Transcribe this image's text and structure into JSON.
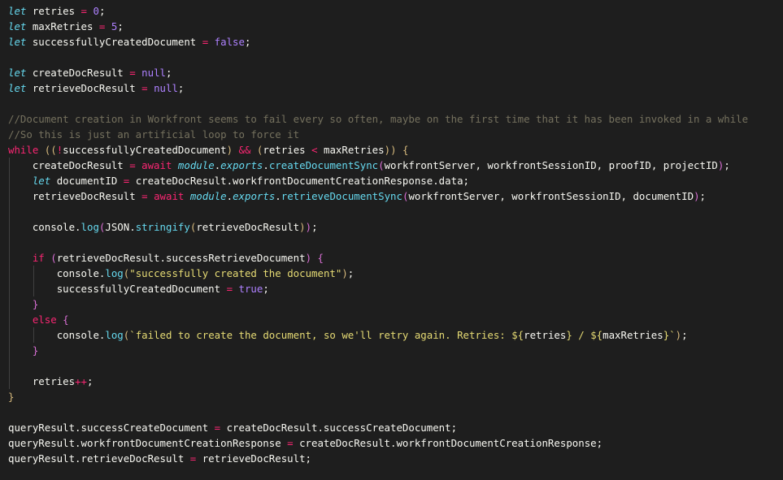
{
  "editor": {
    "background": "#1e1e1e",
    "colors": {
      "keyword": "#66d9ef",
      "control": "#f92672",
      "number": "#ae81ff",
      "comment": "#75715e",
      "string": "#e6db74",
      "function": "#66d9ef",
      "text": "#f8f8f2",
      "brace": "#d7ba7d"
    },
    "lines": [
      [
        {
          "t": "let",
          "c": "keyword-italic"
        },
        {
          "t": " retries ",
          "c": "ident"
        },
        {
          "t": "=",
          "c": "operator"
        },
        {
          "t": " ",
          "c": "plain"
        },
        {
          "t": "0",
          "c": "number"
        },
        {
          "t": ";",
          "c": "plain"
        }
      ],
      [
        {
          "t": "let",
          "c": "keyword-italic"
        },
        {
          "t": " maxRetries ",
          "c": "ident"
        },
        {
          "t": "=",
          "c": "operator"
        },
        {
          "t": " ",
          "c": "plain"
        },
        {
          "t": "5",
          "c": "number"
        },
        {
          "t": ";",
          "c": "plain"
        }
      ],
      [
        {
          "t": "let",
          "c": "keyword-italic"
        },
        {
          "t": " successfullyCreatedDocument ",
          "c": "ident"
        },
        {
          "t": "=",
          "c": "operator"
        },
        {
          "t": " ",
          "c": "plain"
        },
        {
          "t": "false",
          "c": "constant"
        },
        {
          "t": ";",
          "c": "plain"
        }
      ],
      [],
      [
        {
          "t": "let",
          "c": "keyword-italic"
        },
        {
          "t": " createDocResult ",
          "c": "ident"
        },
        {
          "t": "=",
          "c": "operator"
        },
        {
          "t": " ",
          "c": "plain"
        },
        {
          "t": "null",
          "c": "constant"
        },
        {
          "t": ";",
          "c": "plain"
        }
      ],
      [
        {
          "t": "let",
          "c": "keyword-italic"
        },
        {
          "t": " retrieveDocResult ",
          "c": "ident"
        },
        {
          "t": "=",
          "c": "operator"
        },
        {
          "t": " ",
          "c": "plain"
        },
        {
          "t": "null",
          "c": "constant"
        },
        {
          "t": ";",
          "c": "plain"
        }
      ],
      [],
      [
        {
          "t": "//Document creation in Workfront seems to fail every so often, maybe on the first time that it has been invoked in a while",
          "c": "comment"
        }
      ],
      [
        {
          "t": "//So this is just an artificial loop to force it",
          "c": "comment"
        }
      ],
      [
        {
          "t": "while",
          "c": "control"
        },
        {
          "t": " ",
          "c": "plain"
        },
        {
          "t": "((",
          "c": "bracket"
        },
        {
          "t": "!",
          "c": "operator"
        },
        {
          "t": "successfullyCreatedDocument",
          "c": "ident"
        },
        {
          "t": ")",
          "c": "bracket"
        },
        {
          "t": " ",
          "c": "plain"
        },
        {
          "t": "&&",
          "c": "operator"
        },
        {
          "t": " ",
          "c": "plain"
        },
        {
          "t": "(",
          "c": "bracket"
        },
        {
          "t": "retries ",
          "c": "ident"
        },
        {
          "t": "<",
          "c": "operator"
        },
        {
          "t": " maxRetries",
          "c": "ident"
        },
        {
          "t": "))",
          "c": "bracket"
        },
        {
          "t": " ",
          "c": "plain"
        },
        {
          "t": "{",
          "c": "bracket"
        }
      ],
      [
        {
          "t": "    ",
          "c": "plain"
        },
        {
          "t": "createDocResult ",
          "c": "ident"
        },
        {
          "t": "=",
          "c": "operator"
        },
        {
          "t": " ",
          "c": "plain"
        },
        {
          "t": "await",
          "c": "await"
        },
        {
          "t": " ",
          "c": "plain"
        },
        {
          "t": "module",
          "c": "module"
        },
        {
          "t": ".",
          "c": "plain"
        },
        {
          "t": "exports",
          "c": "module"
        },
        {
          "t": ".",
          "c": "plain"
        },
        {
          "t": "createDocumentSync",
          "c": "function"
        },
        {
          "t": "(",
          "c": "paren-alt"
        },
        {
          "t": "workfrontServer, workfrontSessionID, proofID, projectID",
          "c": "ident"
        },
        {
          "t": ")",
          "c": "paren-alt"
        },
        {
          "t": ";",
          "c": "plain"
        }
      ],
      [
        {
          "t": "    ",
          "c": "plain"
        },
        {
          "t": "let",
          "c": "keyword-italic"
        },
        {
          "t": " documentID ",
          "c": "ident"
        },
        {
          "t": "=",
          "c": "operator"
        },
        {
          "t": " createDocResult.workfrontDocumentCreationResponse.data;",
          "c": "ident"
        }
      ],
      [
        {
          "t": "    ",
          "c": "plain"
        },
        {
          "t": "retrieveDocResult ",
          "c": "ident"
        },
        {
          "t": "=",
          "c": "operator"
        },
        {
          "t": " ",
          "c": "plain"
        },
        {
          "t": "await",
          "c": "await"
        },
        {
          "t": " ",
          "c": "plain"
        },
        {
          "t": "module",
          "c": "module"
        },
        {
          "t": ".",
          "c": "plain"
        },
        {
          "t": "exports",
          "c": "module"
        },
        {
          "t": ".",
          "c": "plain"
        },
        {
          "t": "retrieveDocumentSync",
          "c": "function"
        },
        {
          "t": "(",
          "c": "paren-alt"
        },
        {
          "t": "workfrontServer, workfrontSessionID, documentID",
          "c": "ident"
        },
        {
          "t": ")",
          "c": "paren-alt"
        },
        {
          "t": ";",
          "c": "plain"
        }
      ],
      [],
      [
        {
          "t": "    ",
          "c": "plain"
        },
        {
          "t": "console.",
          "c": "ident"
        },
        {
          "t": "log",
          "c": "function"
        },
        {
          "t": "(",
          "c": "paren-alt"
        },
        {
          "t": "JSON.",
          "c": "ident"
        },
        {
          "t": "stringify",
          "c": "function"
        },
        {
          "t": "(",
          "c": "bracket"
        },
        {
          "t": "retrieveDocResult",
          "c": "ident"
        },
        {
          "t": ")",
          "c": "bracket"
        },
        {
          "t": ")",
          "c": "paren-alt"
        },
        {
          "t": ";",
          "c": "plain"
        }
      ],
      [],
      [
        {
          "t": "    ",
          "c": "plain"
        },
        {
          "t": "if",
          "c": "control"
        },
        {
          "t": " ",
          "c": "plain"
        },
        {
          "t": "(",
          "c": "paren-alt"
        },
        {
          "t": "retrieveDocResult.successRetrieveDocument",
          "c": "ident"
        },
        {
          "t": ")",
          "c": "paren-alt"
        },
        {
          "t": " ",
          "c": "plain"
        },
        {
          "t": "{",
          "c": "paren-alt"
        }
      ],
      [
        {
          "t": "        ",
          "c": "plain"
        },
        {
          "t": "console.",
          "c": "ident"
        },
        {
          "t": "log",
          "c": "function"
        },
        {
          "t": "(",
          "c": "bracket"
        },
        {
          "t": "\"successfully created the document\"",
          "c": "string"
        },
        {
          "t": ")",
          "c": "bracket"
        },
        {
          "t": ";",
          "c": "plain"
        }
      ],
      [
        {
          "t": "        ",
          "c": "plain"
        },
        {
          "t": "successfullyCreatedDocument ",
          "c": "ident"
        },
        {
          "t": "=",
          "c": "operator"
        },
        {
          "t": " ",
          "c": "plain"
        },
        {
          "t": "true",
          "c": "constant"
        },
        {
          "t": ";",
          "c": "plain"
        }
      ],
      [
        {
          "t": "    ",
          "c": "plain"
        },
        {
          "t": "}",
          "c": "paren-alt"
        }
      ],
      [
        {
          "t": "    ",
          "c": "plain"
        },
        {
          "t": "else",
          "c": "control"
        },
        {
          "t": " ",
          "c": "plain"
        },
        {
          "t": "{",
          "c": "paren-alt"
        }
      ],
      [
        {
          "t": "        ",
          "c": "plain"
        },
        {
          "t": "console.",
          "c": "ident"
        },
        {
          "t": "log",
          "c": "function"
        },
        {
          "t": "(",
          "c": "bracket"
        },
        {
          "t": "`failed to create the document, so we'll retry again. Retries: ",
          "c": "string"
        },
        {
          "t": "${",
          "c": "string"
        },
        {
          "t": "retries",
          "c": "ident"
        },
        {
          "t": "}",
          "c": "string"
        },
        {
          "t": " / ",
          "c": "string"
        },
        {
          "t": "${",
          "c": "string"
        },
        {
          "t": "maxRetries",
          "c": "ident"
        },
        {
          "t": "}`",
          "c": "string"
        },
        {
          "t": ")",
          "c": "bracket"
        },
        {
          "t": ";",
          "c": "plain"
        }
      ],
      [
        {
          "t": "    ",
          "c": "plain"
        },
        {
          "t": "}",
          "c": "paren-alt"
        }
      ],
      [],
      [
        {
          "t": "    ",
          "c": "plain"
        },
        {
          "t": "retries",
          "c": "ident"
        },
        {
          "t": "++",
          "c": "operator"
        },
        {
          "t": ";",
          "c": "plain"
        }
      ],
      [
        {
          "t": "}",
          "c": "bracket"
        }
      ],
      [],
      [
        {
          "t": "queryResult.successCreateDocument ",
          "c": "ident"
        },
        {
          "t": "=",
          "c": "operator"
        },
        {
          "t": " createDocResult.successCreateDocument;",
          "c": "ident"
        }
      ],
      [
        {
          "t": "queryResult.workfrontDocumentCreationResponse ",
          "c": "ident"
        },
        {
          "t": "=",
          "c": "operator"
        },
        {
          "t": " createDocResult.workfrontDocumentCreationResponse;",
          "c": "ident"
        }
      ],
      [
        {
          "t": "queryResult.retrieveDocResult ",
          "c": "ident"
        },
        {
          "t": "=",
          "c": "operator"
        },
        {
          "t": " retrieveDocResult;",
          "c": "ident"
        }
      ]
    ]
  }
}
